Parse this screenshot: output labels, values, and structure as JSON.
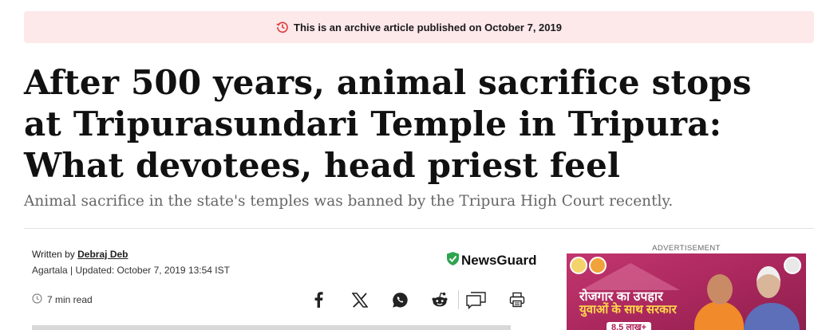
{
  "archive_banner": {
    "text": "This is an archive article published on October 7, 2019",
    "accent": "#e03a3a"
  },
  "article": {
    "headline": "After 500 years, animal sacrifice stops at Tripurasundari Temple in Tripura: What devotees, head priest feel",
    "subhead": "Animal sacrifice in the state's temples was banned by the Tripura High Court recently."
  },
  "byline": {
    "written_by_label": "Written by",
    "author": "Debraj Deb",
    "location": "Agartala",
    "separator": "|",
    "updated": "Updated: October 7, 2019 13:54 IST"
  },
  "newsguard": {
    "label": "NewsGuard",
    "shield_color": "#2ea44f"
  },
  "read_time": "7 min read",
  "share": {
    "icons": [
      "facebook-icon",
      "x-icon",
      "whatsapp-icon",
      "reddit-icon",
      "comment-icon",
      "print-icon"
    ]
  },
  "ad": {
    "label": "ADVERTISEMENT",
    "line1": "रोजगार का उपहार",
    "line2": "युवाओं के साथ सरकार",
    "line3": "8.5 लाख+"
  }
}
